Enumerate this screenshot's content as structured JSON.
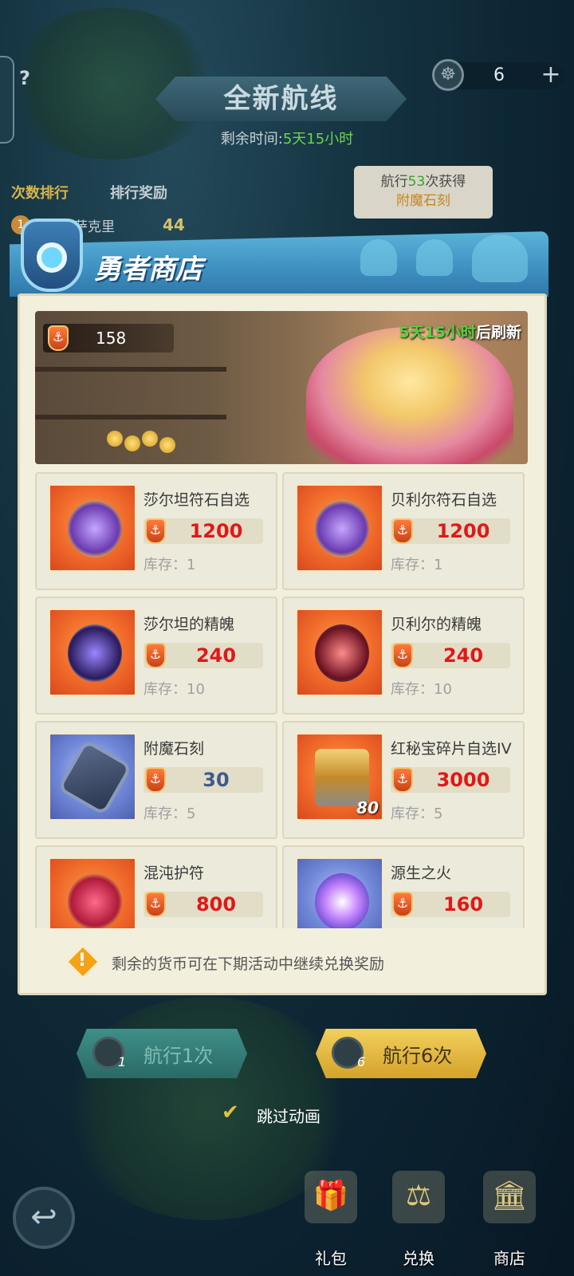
{
  "top": {
    "help_glyph": "?",
    "counter_value": "6",
    "counter_plus": "+",
    "title": "全新航线",
    "remain_label": "剩余时间:",
    "remain_value": "5天15小时",
    "tab_rank": "次数排行",
    "tab_reward": "排行奖励",
    "rank_entry": {
      "name": "黎明的萨克里",
      "value": "44"
    },
    "voyage_tip": {
      "prefix": "航行",
      "count": "53",
      "suffix": "次获得",
      "reward": "附魔石刻"
    }
  },
  "shop": {
    "title": "勇者商店",
    "currency_amount": "158",
    "refresh_time": "5天15小时",
    "refresh_suffix": "后刷新",
    "stock_label": "库存：",
    "items": [
      {
        "name": "莎尔坦符石自选",
        "price": "1200",
        "stock": "1",
        "bg": "orange",
        "qty": ""
      },
      {
        "name": "贝利尔符石自选",
        "price": "1200",
        "stock": "1",
        "bg": "orange",
        "qty": ""
      },
      {
        "name": "莎尔坦的精魄",
        "price": "240",
        "stock": "10",
        "bg": "orange",
        "qty": ""
      },
      {
        "name": "贝利尔的精魄",
        "price": "240",
        "stock": "10",
        "bg": "orange",
        "qty": ""
      },
      {
        "name": "附魔石刻",
        "price": "30",
        "stock": "5",
        "bg": "blue",
        "qty": ""
      },
      {
        "name": "红秘宝碎片自选IV",
        "price": "3000",
        "stock": "5",
        "bg": "orange",
        "qty": "80"
      },
      {
        "name": "混沌护符",
        "price": "800",
        "stock": "",
        "bg": "orange",
        "qty": ""
      },
      {
        "name": "源生之火",
        "price": "160",
        "stock": "",
        "bg": "blue",
        "qty": ""
      }
    ],
    "note": "剩余的货币可在下期活动中继续兑换奖励"
  },
  "bottom": {
    "sail_once": {
      "label": "航行1次",
      "count": "1"
    },
    "sail_six": {
      "label": "航行6次",
      "count": "6"
    },
    "skip_label": "跳过动画",
    "nav": [
      {
        "label": "礼包",
        "icon": "gift-icon"
      },
      {
        "label": "兑换",
        "icon": "scale-icon"
      },
      {
        "label": "商店",
        "icon": "shop-icon"
      }
    ]
  },
  "colors": {
    "price_red": "#e01818",
    "price_blue": "#3e5a90",
    "timer_green": "#52d43c",
    "header_blue": "#3d8fc0"
  }
}
